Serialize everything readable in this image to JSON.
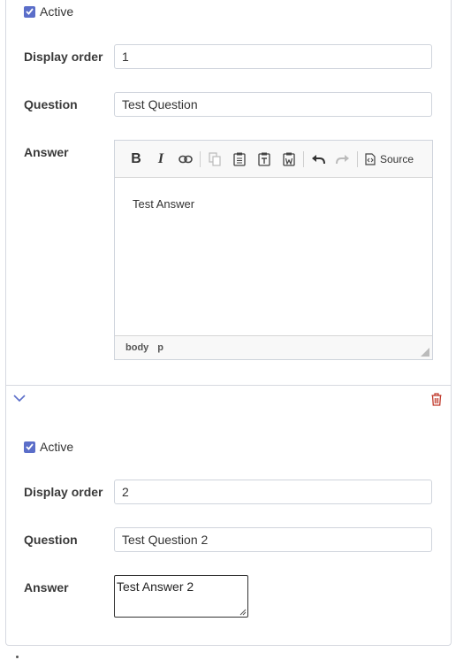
{
  "items": [
    {
      "active_label": "Active",
      "active": true,
      "display_order_label": "Display order",
      "display_order_value": "1",
      "question_label": "Question",
      "question_value": "Test Question",
      "answer_label": "Answer",
      "editor": {
        "toolbar": [
          "bold",
          "italic",
          "link",
          "copy",
          "paste",
          "paste-as-text",
          "paste-from-word",
          "undo",
          "redo",
          "source"
        ],
        "bold_glyph": "B",
        "italic_glyph": "I",
        "source_label": "Source",
        "content": "Test Answer",
        "path": [
          "body",
          "p"
        ]
      }
    },
    {
      "active_label": "Active",
      "active": true,
      "display_order_label": "Display order",
      "display_order_value": "2",
      "question_label": "Question",
      "question_value": "Test Question 2",
      "answer_label": "Answer",
      "answer_value": "Test Answer 2"
    }
  ],
  "colors": {
    "accent": "#5b6ec9",
    "danger": "#c0392b",
    "border": "#d6d9e0"
  }
}
